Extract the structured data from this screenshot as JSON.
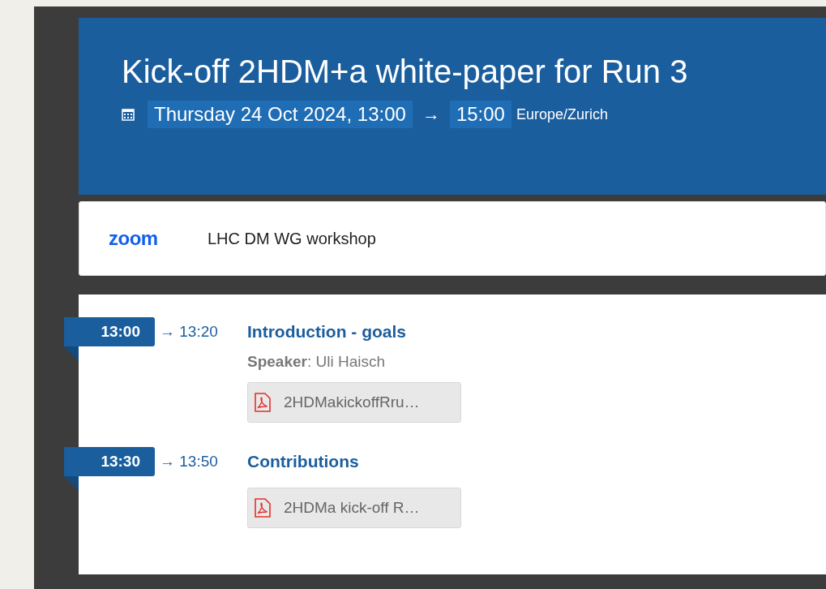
{
  "event": {
    "title": "Kick-off 2HDM+a white-paper for Run 3",
    "start": "Thursday 24 Oct 2024, 13:00",
    "arrow": "→",
    "end": "15:00",
    "timezone": "Europe/Zurich"
  },
  "video_room": {
    "logo": "zoom",
    "name": "LHC DM WG workshop"
  },
  "timetable": [
    {
      "start": "13:00",
      "end": "→ 13:20",
      "title": "Introduction - goals",
      "speaker": "**Speaker**: Uli Haisch",
      "attachments": [
        "2HDMakickoffRru…"
      ]
    },
    {
      "start": "13:30",
      "end": "→ 13:50",
      "title": "Contributions",
      "attachments": [
        "2HDMa kick-off R…"
      ]
    }
  ]
}
